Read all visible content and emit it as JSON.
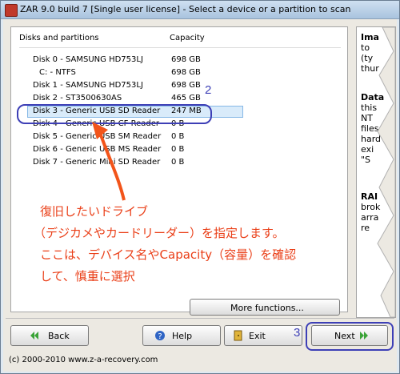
{
  "window": {
    "title": "ZAR 9.0 build 7 [Single user license] - Select a device or a partition to scan"
  },
  "table": {
    "headers": {
      "name": "Disks and partitions",
      "capacity": "Capacity"
    },
    "rows": [
      {
        "name": "Disk 0 - SAMSUNG HD753LJ",
        "capacity": "698 GB"
      },
      {
        "name": "C: - NTFS",
        "capacity": "698 GB"
      },
      {
        "name": "Disk 1 - SAMSUNG HD753LJ",
        "capacity": "698 GB"
      },
      {
        "name": "Disk 2 - ST3500630AS",
        "capacity": "465 GB"
      },
      {
        "name": "Disk 3 - Generic USB SD Reader",
        "capacity": "247 MB"
      },
      {
        "name": "Disk 4 - Generic USB CF Reader",
        "capacity": "0 B"
      },
      {
        "name": "Disk 5 - Generic USB SM Reader",
        "capacity": "0 B"
      },
      {
        "name": "Disk 6 - Generic USB MS Reader",
        "capacity": "0 B"
      },
      {
        "name": "Disk 7 - Generic Mini SD Reader",
        "capacity": "0 B"
      }
    ]
  },
  "annotations": {
    "step2": "2",
    "step3": "3",
    "note_lines": [
      "復旧したいドライブ",
      "（デジカメやカードリーダー）を指定します。",
      "ここは、デバイス名やCapacity（容量）を確認",
      "して、慎重に選択"
    ]
  },
  "right_panel": {
    "lines_1": [
      "Ima",
      "to",
      "(ty",
      "thur"
    ],
    "lines_2": [
      "Data",
      "this",
      "NT",
      "files",
      "hard",
      "exi",
      "\"S"
    ],
    "lines_3": [
      "RAI",
      "brok",
      "arra",
      "re"
    ]
  },
  "buttons": {
    "more": "More functions...",
    "back": "Back",
    "help": "Help",
    "exit": "Exit",
    "next": "Next"
  },
  "footer": "(c) 2000-2010 www.z-a-recovery.com",
  "colors": {
    "annotation_blue": "#3d3fb6",
    "annotation_red": "#ea3f18",
    "selection": "#d9ebfa"
  }
}
